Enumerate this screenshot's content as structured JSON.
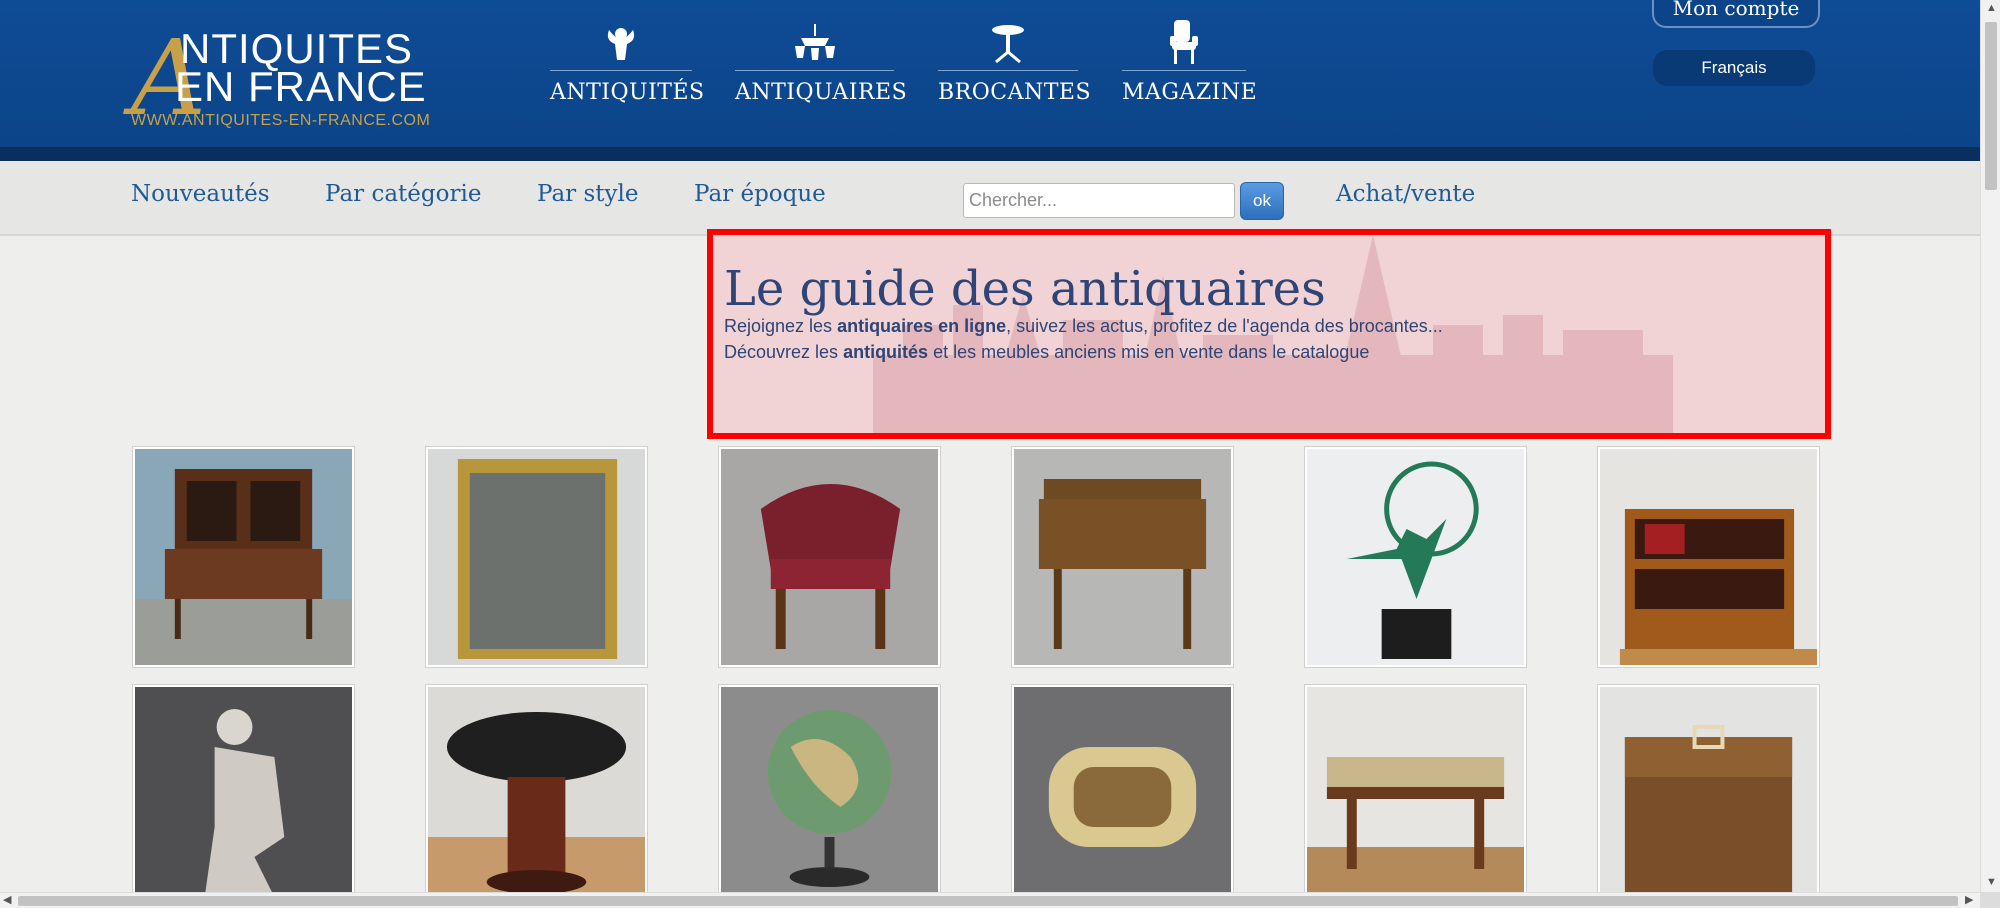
{
  "header": {
    "logo": {
      "big_letter": "A",
      "line1": "NTIQUITES",
      "line2": "EN FRANCE",
      "url": "WWW.ANTIQUITES-EN-FRANCE.COM"
    },
    "nav": [
      {
        "label": "ANTIQUITÉS",
        "icon": "cherub-icon"
      },
      {
        "label": "ANTIQUAIRES",
        "icon": "chandelier-icon"
      },
      {
        "label": "BROCANTES",
        "icon": "pedestal-table-icon"
      },
      {
        "label": "MAGAZINE",
        "icon": "armchair-icon"
      }
    ],
    "account_label": "Mon compte",
    "language_label": "Français"
  },
  "subnav": {
    "links": [
      "Nouveautés",
      "Par catégorie",
      "Par style",
      "Par époque"
    ],
    "search_placeholder": "Chercher...",
    "search_button": "ok",
    "buy_sell": "Achat/vente"
  },
  "guide": {
    "title": "Le guide des antiquaires",
    "line1": {
      "pre": "Rejoignez les ",
      "bold": "antiquaires en ligne",
      "post": ", suivez les actus, profitez de l'agenda des brocantes..."
    },
    "line2": {
      "pre": "Découvrez les ",
      "bold": "antiquités",
      "post": " et les meubles anciens mis en vente dans le catalogue"
    }
  },
  "products": [
    {
      "name": "secretary-bookcase-image"
    },
    {
      "name": "gilt-mirror-image"
    },
    {
      "name": "red-leather-armchair-image"
    },
    {
      "name": "writing-desk-image"
    },
    {
      "name": "art-deco-dancer-statue-image"
    },
    {
      "name": "bookshelf-cabinet-image"
    },
    {
      "name": "marble-woman-statue-image"
    },
    {
      "name": "round-pedestal-table-image"
    },
    {
      "name": "globe-image"
    },
    {
      "name": "carved-box-image"
    },
    {
      "name": "low-coffee-table-image"
    },
    {
      "name": "wooden-box-image"
    }
  ],
  "colors": {
    "header_blue": "#0f4c96",
    "gold": "#c8a048",
    "link_blue": "#1f5a97",
    "highlight_border": "#ff0000",
    "highlight_fill": "#f1d3d5"
  }
}
